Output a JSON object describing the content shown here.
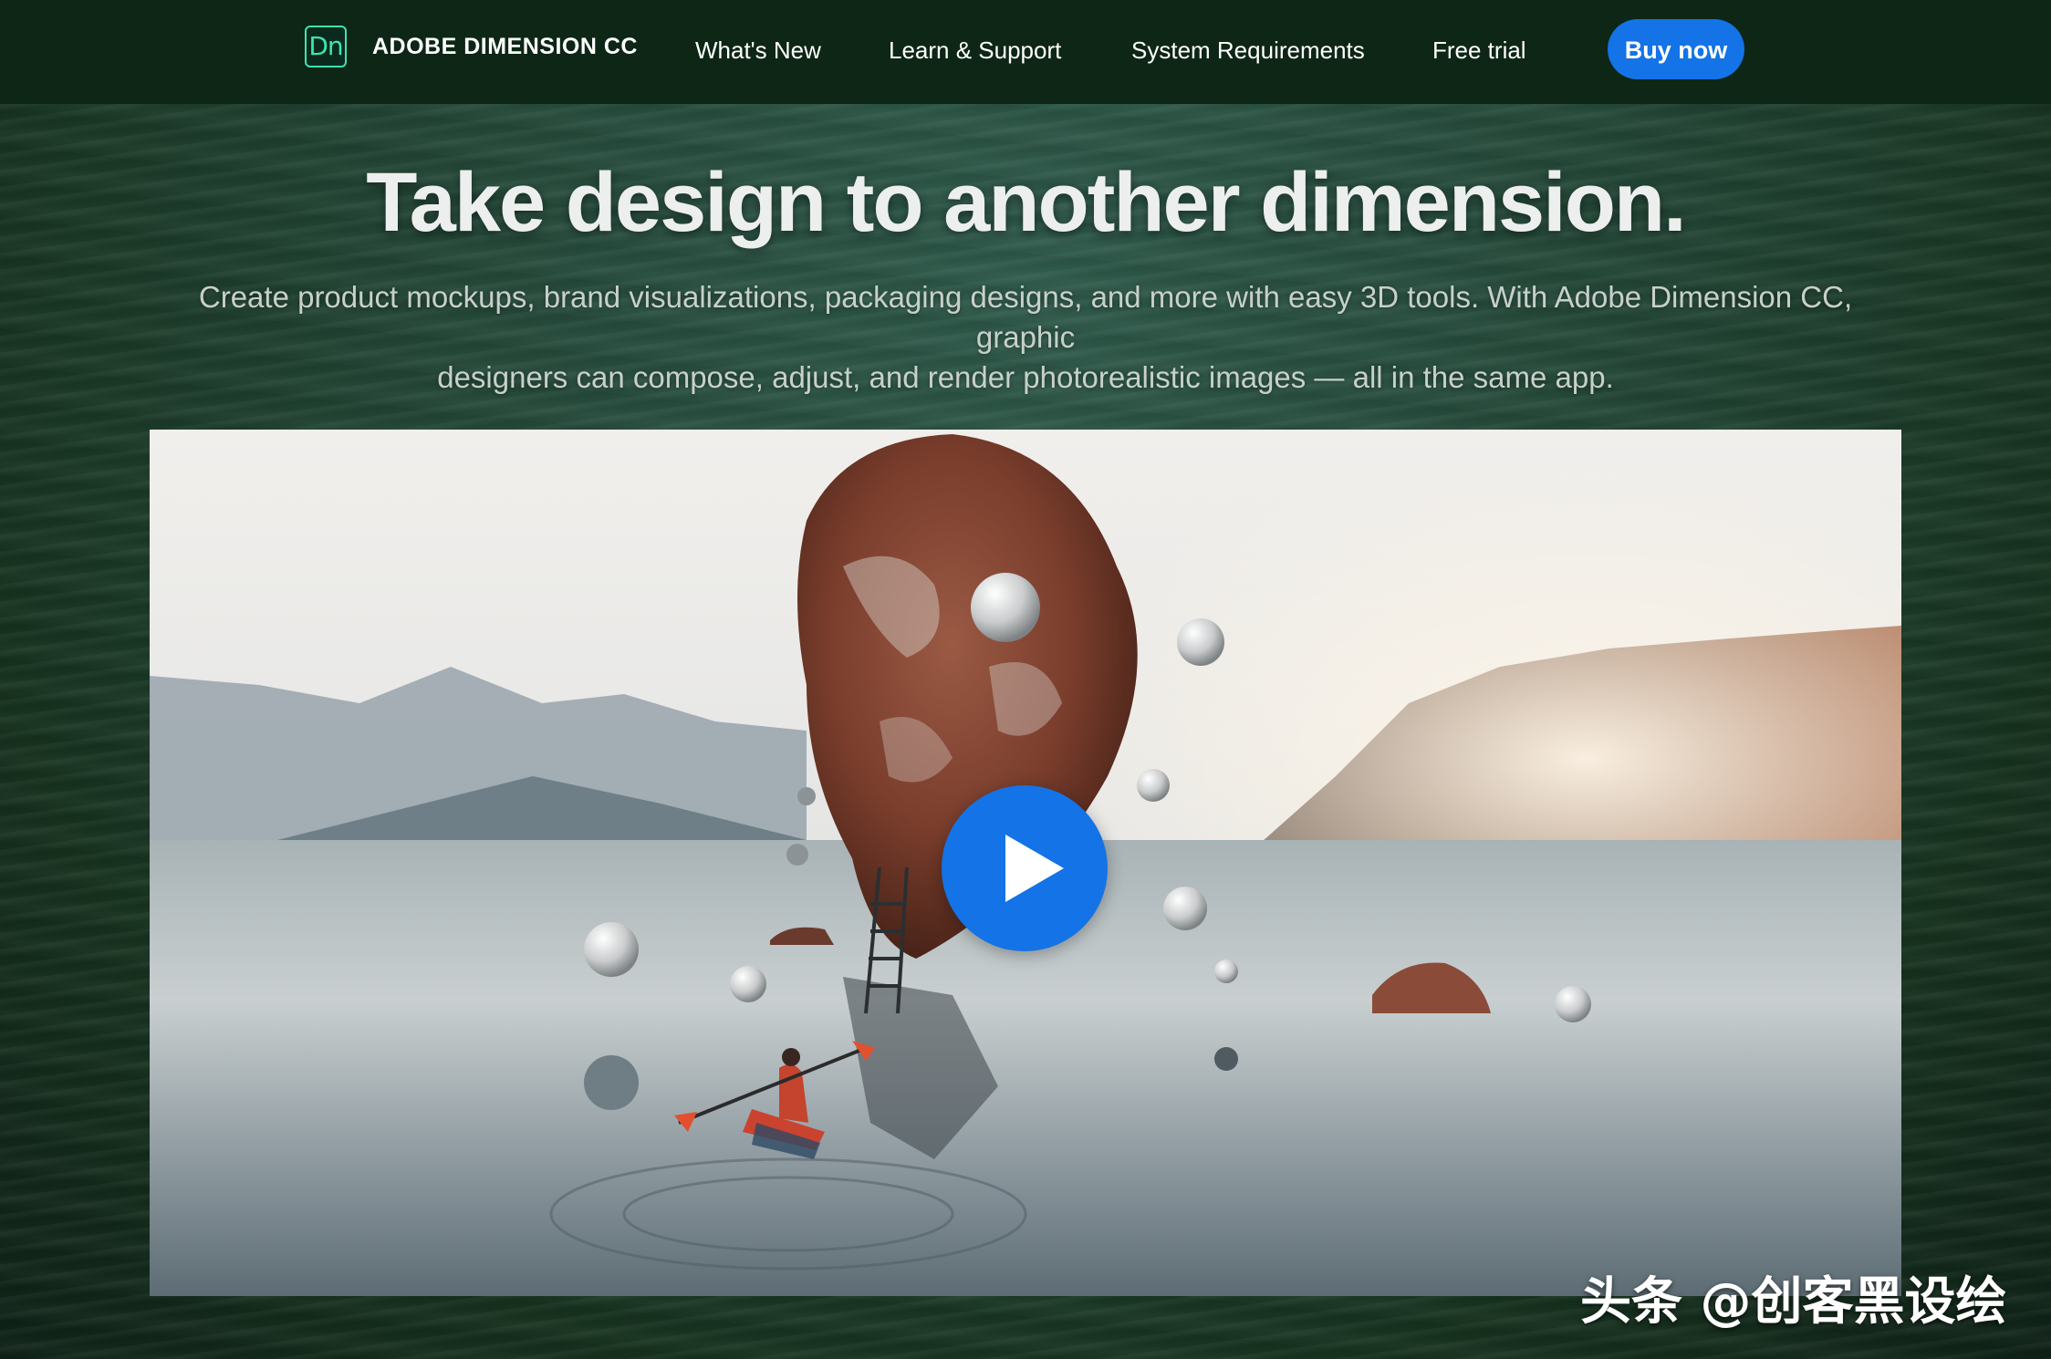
{
  "nav": {
    "logo_text": "Dn",
    "brand_name": "ADOBE DIMENSION CC",
    "links": [
      "What's New",
      "Learn & Support",
      "System Requirements",
      "Free trial"
    ],
    "cta": "Buy now"
  },
  "hero": {
    "headline": "Take design to another dimension.",
    "subtext_line1": "Create product mockups, brand visualizations, packaging designs, and more with easy 3D tools. With Adobe Dimension CC, graphic",
    "subtext_line2": "designers can compose, adjust, and render photorealistic images — all in the same app."
  },
  "video": {
    "scene": "lake-kayak-floating-rock",
    "play_icon": "play-icon"
  },
  "watermark": "头条 @创客黑设绘",
  "colors": {
    "nav_bg": "#0d2615",
    "accent": "#1473e6",
    "logo_green": "#3ee3b0"
  }
}
